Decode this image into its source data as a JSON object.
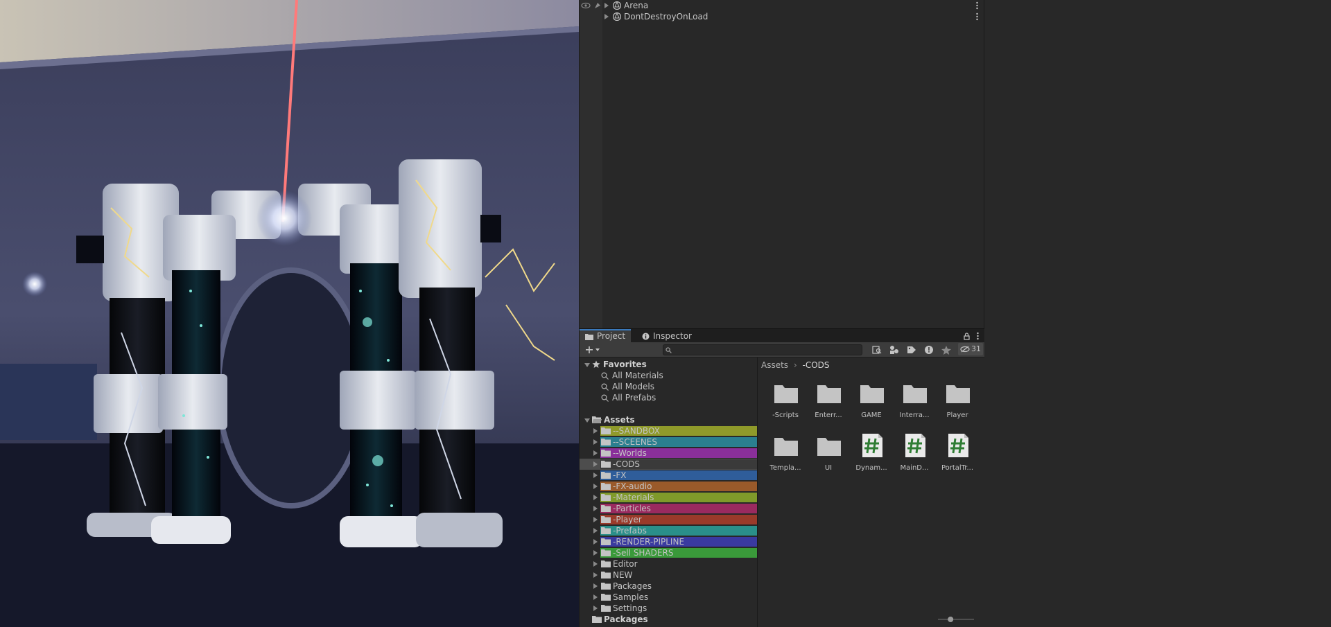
{
  "hierarchy": {
    "rows": [
      {
        "label": "Arena"
      },
      {
        "label": "DontDestroyOnLoad"
      }
    ]
  },
  "project": {
    "tabs": [
      {
        "label": "Project",
        "icon": "folder-icon"
      },
      {
        "label": "Inspector",
        "icon": "info-icon"
      }
    ],
    "search": {
      "value": "",
      "placeholder": ""
    },
    "hidden_count": "31",
    "favorites": {
      "label": "Favorites",
      "items": [
        "All Materials",
        "All Models",
        "All Prefabs"
      ]
    },
    "assets": {
      "label": "Assets",
      "folders": [
        {
          "label": "--SANDBOX",
          "color": "#8f9a2a"
        },
        {
          "label": "--SCEENES",
          "color": "#2a7f8f"
        },
        {
          "label": "--Worlds",
          "color": "#8a2f9a"
        },
        {
          "label": "-CODS",
          "color": "#3a3a3a"
        },
        {
          "label": "-FX",
          "color": "#2f5d9a"
        },
        {
          "label": "-FX-audio",
          "color": "#9a5a2a"
        },
        {
          "label": "-Materials",
          "color": "#7f9a2a"
        },
        {
          "label": "-Particles",
          "color": "#9a2a5f"
        },
        {
          "label": "-Player",
          "color": "#9a3a2a"
        },
        {
          "label": "-Prefabs",
          "color": "#2a8f8a"
        },
        {
          "label": "-RENDER-PIPLINE",
          "color": "#3a3aa0"
        },
        {
          "label": "-Sell SHADERS",
          "color": "#3a9a3a"
        },
        {
          "label": "Editor",
          "color": ""
        },
        {
          "label": "NEW",
          "color": ""
        },
        {
          "label": "Packages",
          "color": ""
        },
        {
          "label": "Samples",
          "color": ""
        },
        {
          "label": "Settings",
          "color": ""
        }
      ]
    },
    "packages_label": "Packages",
    "breadcrumb": {
      "root": "Assets",
      "current": "-CODS"
    },
    "grid_items": [
      {
        "label": "-Scripts",
        "kind": "folder"
      },
      {
        "label": "Enterr...",
        "kind": "folder"
      },
      {
        "label": "GAME",
        "kind": "folder"
      },
      {
        "label": "Interra...",
        "kind": "folder"
      },
      {
        "label": "Player",
        "kind": "folder"
      },
      {
        "label": "Templa...",
        "kind": "folder"
      },
      {
        "label": "UI",
        "kind": "folder"
      },
      {
        "label": "Dynam...",
        "kind": "script"
      },
      {
        "label": "MainD...",
        "kind": "script"
      },
      {
        "label": "PortalTr...",
        "kind": "script"
      }
    ],
    "zoom_slider": 0.35
  }
}
